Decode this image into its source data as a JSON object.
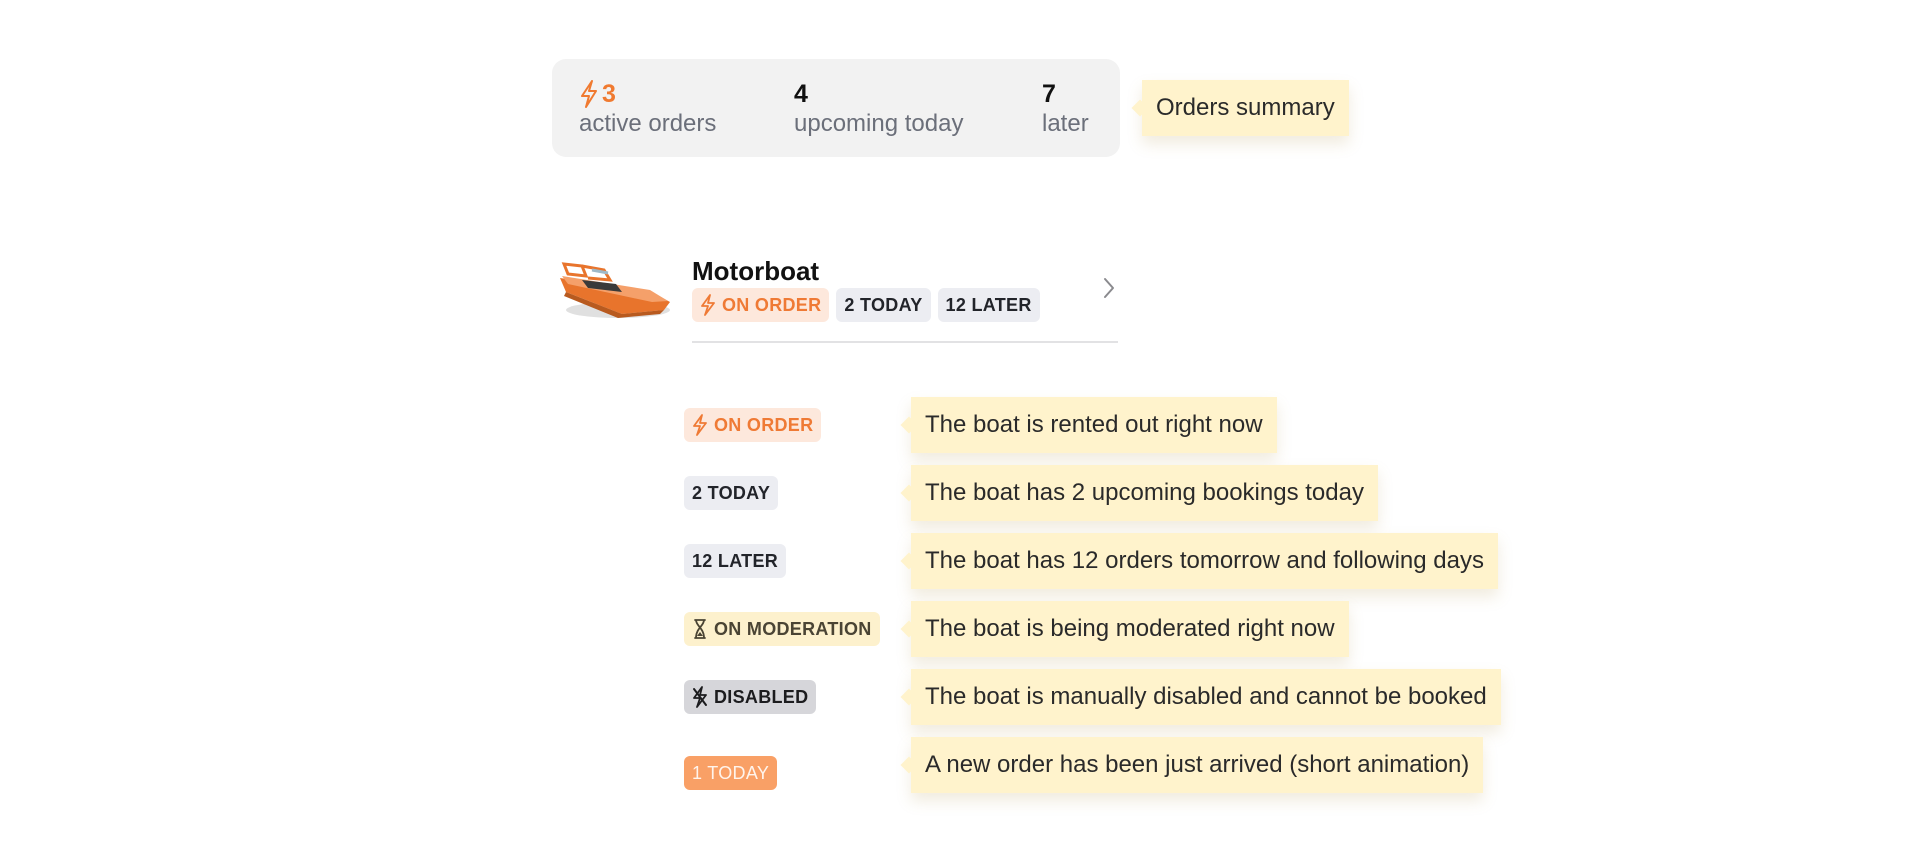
{
  "summary": {
    "active": {
      "value": "3",
      "label": "active orders"
    },
    "today": {
      "value": "4",
      "label": "upcoming today"
    },
    "later": {
      "value": "7",
      "label": "later"
    },
    "note": "Orders summary"
  },
  "boat": {
    "name": "Motorboat",
    "tags": {
      "on_order": "ON ORDER",
      "today": "2 TODAY",
      "later": "12 LATER"
    }
  },
  "legend": [
    {
      "tag": "ON ORDER",
      "note": "The boat is rented out right now"
    },
    {
      "tag": "2 TODAY",
      "note": "The boat has 2 upcoming bookings today"
    },
    {
      "tag": "12 LATER",
      "note": "The boat has 12 orders tomorrow and following days"
    },
    {
      "tag": "ON MODERATION",
      "note": "The boat is being moderated right now"
    },
    {
      "tag": "DISABLED",
      "note": "The boat is manually disabled and cannot be booked"
    },
    {
      "tag": "1 TODAY",
      "note": "A new order has been just arrived (short animation)"
    }
  ],
  "colors": {
    "accent": "#f07a30",
    "note_bg": "#fff3cc",
    "card_bg": "#f2f2f2"
  },
  "icons": [
    "lightning-icon",
    "hourglass-icon",
    "disabled-lightning-icon",
    "chevron-right-icon",
    "boat-image"
  ]
}
